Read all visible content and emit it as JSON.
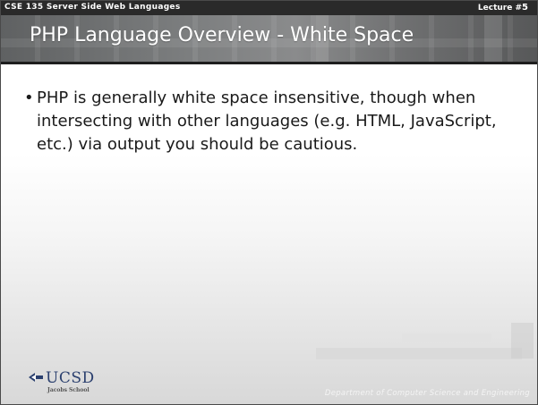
{
  "header": {
    "course": "CSE 135   Server Side Web Languages",
    "lecture_prefix": "Lecture #",
    "lecture_number": "5"
  },
  "slide": {
    "title": "PHP Language Overview - White Space",
    "bullets": [
      {
        "text": "PHP is generally white space insensitive, though when intersecting with other languages (e.g. HTML, JavaScript, etc.) via output you should be cautious."
      }
    ]
  },
  "logo": {
    "name": "UCSD",
    "subtitle": "Jacobs School"
  },
  "footer": {
    "department": "Department of Computer Science and Engineering"
  }
}
